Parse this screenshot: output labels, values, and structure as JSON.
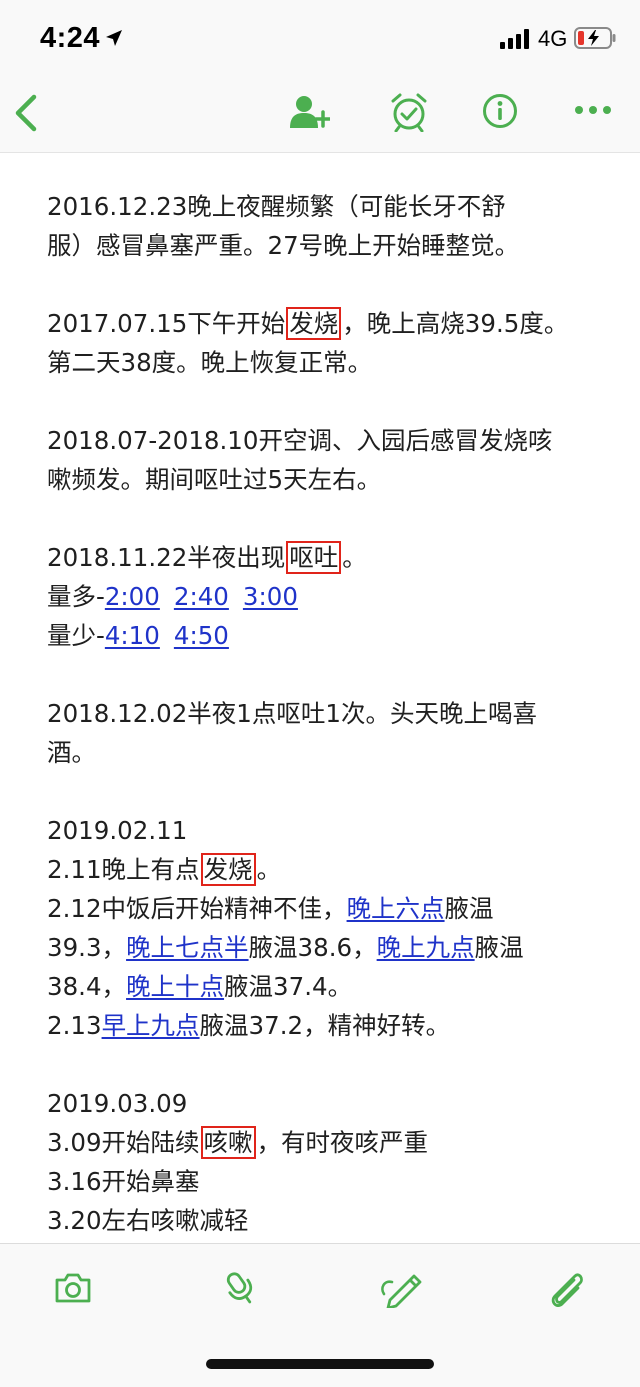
{
  "status_bar": {
    "time": "4:24",
    "network": "4G"
  },
  "colors": {
    "accent": "#4caf50",
    "link": "#1f33c9",
    "highlight_box": "#e0241a",
    "battery_low": "#e5352b"
  },
  "toolbar": {
    "icons": [
      "back-icon",
      "add-person-icon",
      "alarm-clock-icon",
      "info-icon",
      "more-icon"
    ]
  },
  "note": {
    "p1": {
      "l1": "2016.12.23晚上夜醒频繁（可能长牙不舒",
      "l2": "服）感冒鼻塞严重。27号晚上开始睡整觉。"
    },
    "p2": {
      "l1_pre": "2017.07.15下午开始",
      "l1_hl": "发烧",
      "l1_post": "，晚上高烧39.5度。",
      "l2": "第二天38度。晚上恢复正常。"
    },
    "p3": {
      "l1": "2018.07-2018.10开空调、入园后感冒发烧咳",
      "l2": "嗽频发。期间呕吐过5天左右。"
    },
    "p4": {
      "l1_pre": "2018.11.22半夜出现",
      "l1_hl": "呕吐",
      "l1_post": "。",
      "l2_label": "量多-",
      "l2_links": [
        "2:00",
        "2:40",
        "3:00"
      ],
      "l3_label": "量少-",
      "l3_links": [
        "4:10",
        "4:50"
      ]
    },
    "p5": {
      "l1": "2018.12.02半夜1点呕吐1次。头天晚上喝喜",
      "l2": "酒。"
    },
    "p6": {
      "l1": "2019.02.11",
      "l2_pre": "2.11晚上有点",
      "l2_hl": "发烧",
      "l2_post": "。",
      "l3_pre": "2.12中饭后开始精神不佳，",
      "l3_link": "晚上六点",
      "l3_post": "腋温",
      "l4_a": "39.3，",
      "l4_link1": "晚上七点半",
      "l4_b": "腋温38.6，",
      "l4_link2": "晚上九点",
      "l4_c": "腋温",
      "l5_a": "38.4，",
      "l5_link": "晚上十点",
      "l5_b": "腋温37.4。",
      "l6_a": "2.13",
      "l6_link": "早上九点",
      "l6_b": "腋温37.2，精神好转。"
    },
    "p7": {
      "l1": "2019.03.09",
      "l2_pre": "3.09开始陆续",
      "l2_hl": "咳嗽",
      "l2_post": "，有时夜咳严重",
      "l3": "3.16开始鼻塞",
      "l4": "3.20左右咳嗽减轻"
    }
  },
  "bottom_bar": {
    "icons": [
      "camera-icon",
      "microphone-icon",
      "pen-icon",
      "paperclip-icon"
    ]
  }
}
